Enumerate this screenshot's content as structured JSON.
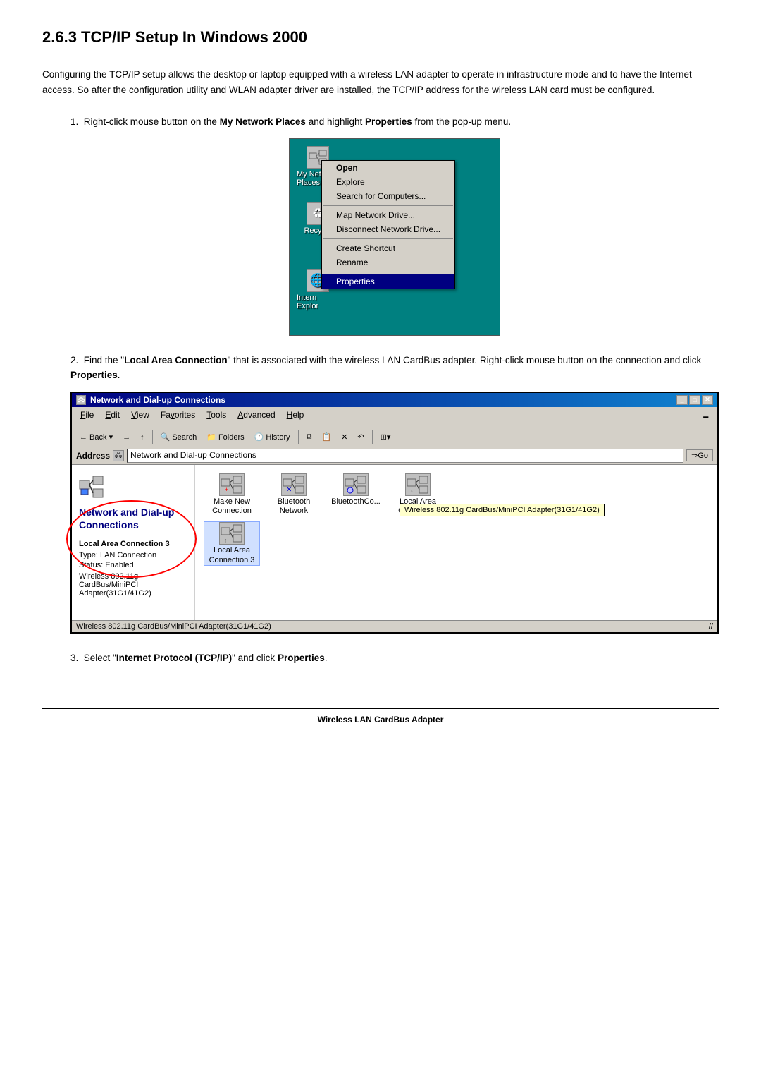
{
  "title": "2.6.3  TCP/IP Setup In Windows 2000",
  "intro": "Configuring the TCP/IP setup allows the desktop or laptop equipped with a wireless LAN adapter to operate in infrastructure mode and to have the Internet access. So after the configuration utility and WLAN adapter driver are installed, the TCP/IP address for the wireless LAN card must be configured.",
  "steps": [
    {
      "number": "1.",
      "text_before": "Right-click mouse button on the ",
      "bold1": "My Network Places",
      "text_middle": " and highlight ",
      "bold2": "Properties",
      "text_after": " from the pop-up menu."
    },
    {
      "number": "2.",
      "text_before": "Find the \"",
      "bold1": "Local Area Connection",
      "text_middle": "\" that is associated with the wireless LAN CardBus adapter. Right-click mouse button on the connection and click ",
      "bold2": "Properties",
      "text_after": "."
    },
    {
      "number": "3.",
      "text_before": "Select \"",
      "bold1": "Internet Protocol (TCP/IP)",
      "text_middle": "\" and click ",
      "bold2": "Properties",
      "text_after": "."
    }
  ],
  "context_menu": {
    "items": [
      "Open",
      "Explore",
      "Search for Computers...",
      "",
      "Map Network Drive...",
      "Disconnect Network Drive...",
      "",
      "Create Shortcut",
      "Rename",
      "",
      "Properties"
    ],
    "highlighted": "Properties"
  },
  "desktop_icons": [
    {
      "label": "My Network Places"
    },
    {
      "label": "Recycle"
    },
    {
      "label": "Intern Explor"
    }
  ],
  "dialog": {
    "title": "Network and Dial-up Connections",
    "menu": [
      "File",
      "Edit",
      "View",
      "Favorites",
      "Tools",
      "Advanced",
      "Help"
    ],
    "address": "Network and Dial-up Connections",
    "sidebar": {
      "title": "Network and Dial-up Connections",
      "connection_name": "Local Area Connection 3",
      "type": "Type: LAN Connection",
      "status": "Status: Enabled",
      "adapter": "Wireless 802.11g CardBus/MiniPCI Adapter(31G1/41G2)"
    },
    "icons": [
      {
        "label": "Make New\nConnection"
      },
      {
        "label": "Bluetooth\nNetwork"
      },
      {
        "label": "BluetoothCo..."
      },
      {
        "label": "Local Area\nConnection"
      },
      {
        "label": "Local Area\nConnection 3"
      }
    ],
    "tooltip": "Wireless 802.11g CardBus/MiniPCI Adapter(31G1/41G2)",
    "statusbar": "Wireless 802.11g CardBus/MiniPCI Adapter(31G1/41G2)"
  },
  "footer": "Wireless LAN CardBus Adapter"
}
